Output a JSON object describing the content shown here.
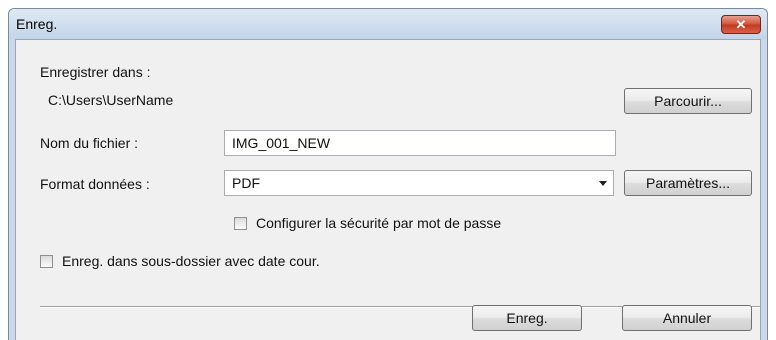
{
  "window": {
    "title": "Enreg.",
    "close_label": "✕"
  },
  "save_in": {
    "label": "Enregistrer dans :",
    "path": "C:\\Users\\UserName",
    "browse_label": "Parcourir..."
  },
  "file_name": {
    "label": "Nom du fichier :",
    "value": "IMG_001_NEW"
  },
  "data_format": {
    "label": "Format données :",
    "selected": "PDF",
    "settings_label": "Paramètres..."
  },
  "password_security": {
    "label": "Configurer la sécurité par mot de passe",
    "checked": false
  },
  "subfolder": {
    "label": "Enreg. dans sous-dossier avec date cour.",
    "checked": false
  },
  "footer": {
    "save_label": "Enreg.",
    "cancel_label": "Annuler"
  }
}
